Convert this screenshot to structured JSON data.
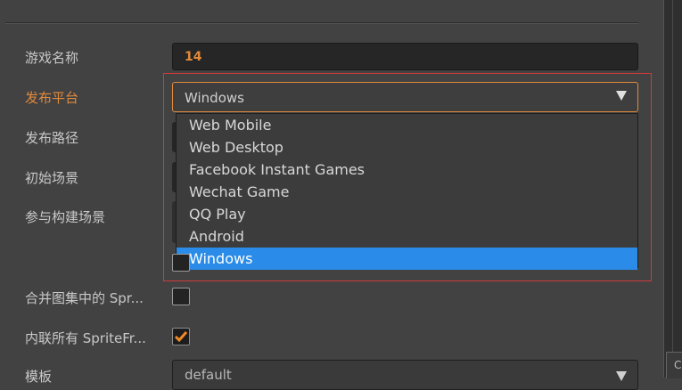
{
  "form": {
    "labels": {
      "game_name": "游戏名称",
      "platform": "发布平台",
      "build_path": "发布路径",
      "start_scene": "初始场景",
      "included_scenes": "参与构建场景",
      "merge_atlas": "合并图集中的 Spr...",
      "inline_sprite": "内联所有 SpriteFr...",
      "template": "模板"
    },
    "game_name_value": "14",
    "platform_value": "Windows",
    "template_value": "default",
    "merge_atlas_checked": false,
    "inline_sprite_checked": true
  },
  "dropdown": {
    "options": [
      "Web Mobile",
      "Web Desktop",
      "Facebook Instant Games",
      "Wechat Game",
      "QQ Play",
      "Android",
      "Windows"
    ],
    "selected": "Windows"
  },
  "colors": {
    "accent": "#e08a3c",
    "selection": "#2a8ce8",
    "highlight_box": "#d23a3a"
  },
  "side_panel": {
    "partial_text": "C"
  }
}
